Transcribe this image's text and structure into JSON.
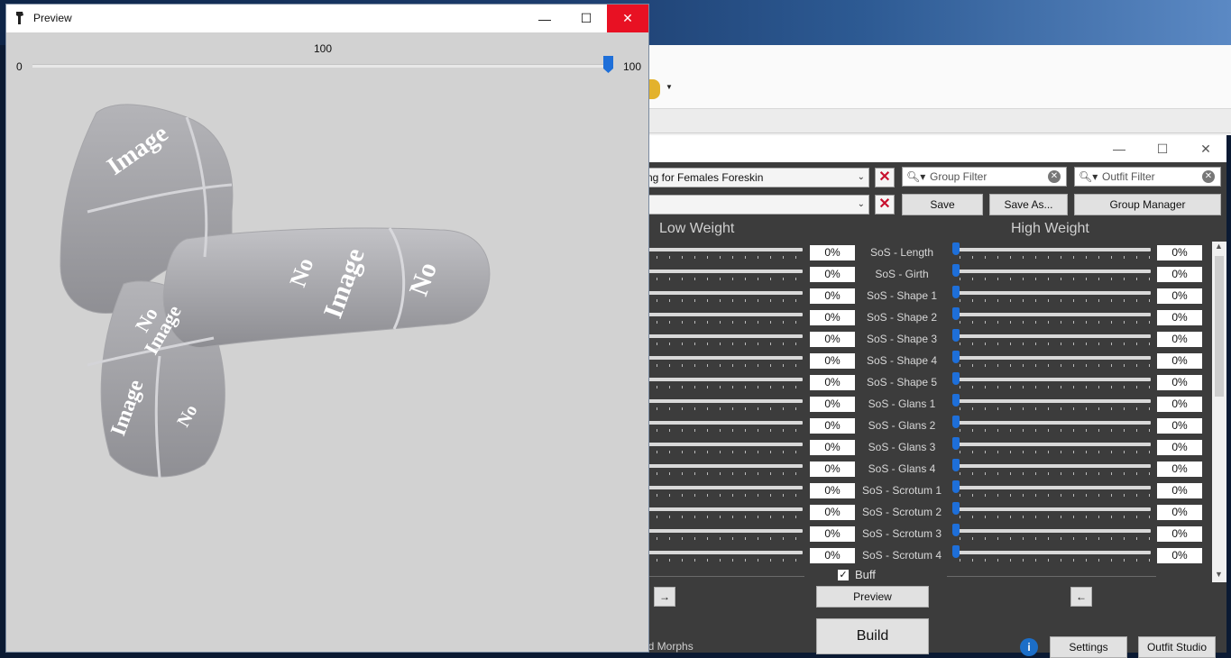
{
  "preview": {
    "title": "Preview",
    "slider": {
      "min_label": "0",
      "max_label": "100",
      "value_label": "100",
      "value": 100
    },
    "model_texture_text": "No Image"
  },
  "bodyslide": {
    "preset_combo": "ng for Females Foreskin",
    "second_combo": "",
    "group_filter_placeholder": "Group Filter",
    "outfit_filter_placeholder": "Outfit Filter",
    "save_label": "Save",
    "save_as_label": "Save As...",
    "group_manager_label": "Group Manager",
    "low_weight_header": "Low Weight",
    "high_weight_header": "High Weight",
    "sliders": [
      {
        "label": "SoS - Length",
        "low": "0%",
        "high": "0%"
      },
      {
        "label": "SoS - Girth",
        "low": "0%",
        "high": "0%"
      },
      {
        "label": "SoS - Shape 1",
        "low": "0%",
        "high": "0%"
      },
      {
        "label": "SoS - Shape 2",
        "low": "0%",
        "high": "0%"
      },
      {
        "label": "SoS - Shape 3",
        "low": "0%",
        "high": "0%"
      },
      {
        "label": "SoS - Shape 4",
        "low": "0%",
        "high": "0%"
      },
      {
        "label": "SoS - Shape 5",
        "low": "0%",
        "high": "0%"
      },
      {
        "label": "SoS - Glans 1",
        "low": "0%",
        "high": "0%"
      },
      {
        "label": "SoS - Glans 2",
        "low": "0%",
        "high": "0%"
      },
      {
        "label": "SoS - Glans 3",
        "low": "0%",
        "high": "0%"
      },
      {
        "label": "SoS - Glans 4",
        "low": "0%",
        "high": "0%"
      },
      {
        "label": "SoS - Scrotum 1",
        "low": "0%",
        "high": "0%"
      },
      {
        "label": "SoS - Scrotum 2",
        "low": "0%",
        "high": "0%"
      },
      {
        "label": "SoS - Scrotum 3",
        "low": "0%",
        "high": "0%"
      },
      {
        "label": "SoS - Scrotum 4",
        "low": "0%",
        "high": "0%"
      }
    ],
    "buff_label": "Buff",
    "arrow_right": "→",
    "arrow_left": "←",
    "preview_button": "Preview",
    "build_button": "Build",
    "build_morphs_label": "ld Morphs",
    "settings_button": "Settings",
    "outfit_studio_button": "Outfit Studio"
  },
  "colors": {
    "accent": "#1e6fd9",
    "close_red": "#e81123",
    "panel_bg": "#3c3c3c",
    "clear_x": "#c8102e"
  }
}
